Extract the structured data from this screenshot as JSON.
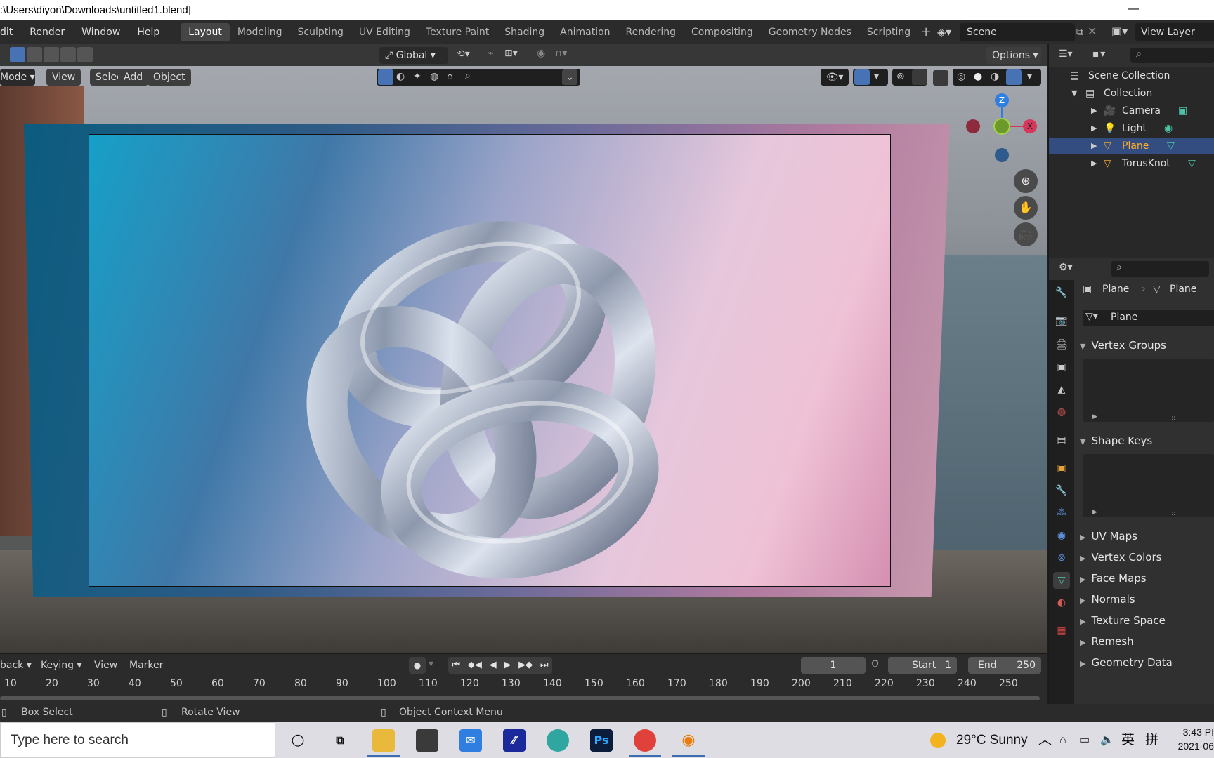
{
  "window": {
    "title": ":\\Users\\diyon\\Downloads\\untitled1.blend]",
    "minimize": "—",
    "close": "✕"
  },
  "topbar": {
    "menus": [
      "dit",
      "Render",
      "Window",
      "Help"
    ],
    "workspaces": [
      "Layout",
      "Modeling",
      "Sculpting",
      "UV Editing",
      "Texture Paint",
      "Shading",
      "Animation",
      "Rendering",
      "Compositing",
      "Geometry Nodes",
      "Scripting"
    ],
    "active_workspace": "Layout",
    "add_workspace": "+",
    "scene_name": "Scene",
    "view_layer": "View Layer"
  },
  "viewport": {
    "transform_orientation": "Global",
    "options": "Options",
    "mode": "Mode",
    "menus": [
      "View",
      "Select",
      "Add",
      "Object"
    ],
    "gizmo": {
      "z": "Z",
      "x": "X"
    }
  },
  "outliner": {
    "root": "Scene Collection",
    "collection": "Collection",
    "items": [
      {
        "name": "Camera",
        "type": "camera",
        "selected": false
      },
      {
        "name": "Light",
        "type": "light",
        "selected": false
      },
      {
        "name": "Plane",
        "type": "mesh",
        "selected": true
      },
      {
        "name": "TorusKnot",
        "type": "mesh",
        "selected": false
      }
    ]
  },
  "properties": {
    "breadcrumb_object": "Plane",
    "breadcrumb_data": "Plane",
    "data_name": "Plane",
    "panels": [
      {
        "label": "Vertex Groups",
        "expanded": true
      },
      {
        "label": "Shape Keys",
        "expanded": true
      },
      {
        "label": "UV Maps",
        "expanded": false
      },
      {
        "label": "Vertex Colors",
        "expanded": false
      },
      {
        "label": "Face Maps",
        "expanded": false
      },
      {
        "label": "Normals",
        "expanded": false
      },
      {
        "label": "Texture Space",
        "expanded": false
      },
      {
        "label": "Remesh",
        "expanded": false
      },
      {
        "label": "Geometry Data",
        "expanded": false
      }
    ]
  },
  "timeline": {
    "playback": "back",
    "keying": "Keying",
    "view": "View",
    "marker": "Marker",
    "current_frame": "1",
    "start_label": "Start",
    "start": "1",
    "end_label": "End",
    "end": "250",
    "ruler": [
      "10",
      "20",
      "30",
      "40",
      "50",
      "60",
      "70",
      "80",
      "90",
      "100",
      "110",
      "120",
      "130",
      "140",
      "150",
      "160",
      "170",
      "180",
      "190",
      "200",
      "210",
      "220",
      "230",
      "240",
      "250"
    ]
  },
  "statusbar": {
    "left": "Box Select",
    "middle": "Rotate View",
    "right": "Object Context Menu"
  },
  "taskbar": {
    "search_placeholder": "Type here to search",
    "weather": "29°C  Sunny",
    "ime": "英",
    "ime2": "拼",
    "time": "3:43 PI",
    "date": "2021-06"
  },
  "colors": {
    "accent_blue": "#4772b3",
    "selection_orange": "#ffaf29",
    "axis_x": "#d7375a",
    "axis_y": "#6b9a2a",
    "axis_z": "#2f7ee0"
  }
}
